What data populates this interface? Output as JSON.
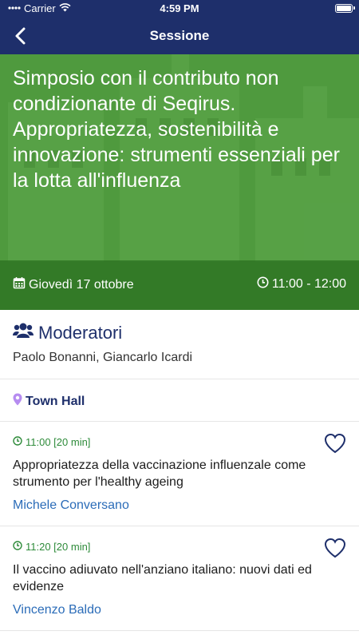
{
  "status_bar": {
    "carrier": "Carrier",
    "time": "4:59 PM"
  },
  "nav": {
    "title": "Sessione",
    "back_icon": "chevron-left-icon"
  },
  "session": {
    "title": "Simposio con il contributo non condizionante di Seqirus. Appropriatezza, sostenibilità e innovazione: strumenti essenziali per la lotta all'influenza",
    "date": "Giovedì 17 ottobre",
    "time": "11:00 - 12:00",
    "hero_color": "#4f9a3e"
  },
  "moderators": {
    "heading": "Moderatori",
    "names": "Paolo Bonanni, Giancarlo Icardi",
    "icon": "users-icon"
  },
  "room": {
    "label": "Town Hall",
    "icon": "map-pin-icon",
    "icon_color": "#b68cf0"
  },
  "talks": [
    {
      "time": "11:00 [20 min]",
      "title": "Appropriatezza della vaccinazione influenzale come strumento per l'healthy ageing",
      "speaker": "Michele Conversano"
    },
    {
      "time": "11:20 [20 min]",
      "title": "Il vaccino adiuvato nell'anziano italiano: nuovi dati ed evidenze",
      "speaker": "Vincenzo Baldo"
    }
  ],
  "colors": {
    "navy": "#1e2f6b",
    "green_text": "#2e8b3a",
    "link_blue": "#2b6cb8"
  }
}
